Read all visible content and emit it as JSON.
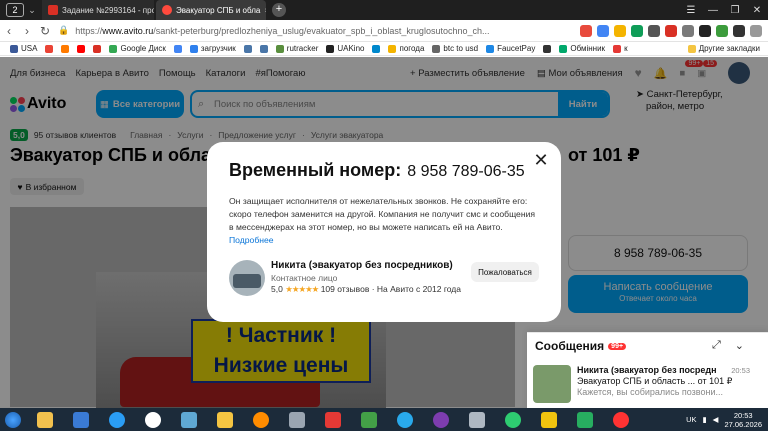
{
  "browser": {
    "tab_count": "2",
    "tabs": [
      {
        "title": "Задание №2993164 - про",
        "active": false,
        "favicon_color": "#d93025"
      },
      {
        "title": "Эвакуатор СПБ и обла",
        "active": true,
        "favicon_color": "#ff4a3d"
      }
    ],
    "url_prefix": "https://",
    "url_domain": "www.avito.ru",
    "url_path": "/sankt-peterburg/predlozheniya_uslug/evakuator_spb_i_oblast_kruglosutochno_ch...",
    "bookmarks": [
      {
        "label": "USA",
        "color": "#3b5998"
      },
      {
        "label": "",
        "color": "#ea4335"
      },
      {
        "label": "",
        "color": "#ff7a00"
      },
      {
        "label": "",
        "color": "#ff0000"
      },
      {
        "label": "",
        "color": "#d93025"
      },
      {
        "label": "Google Диск",
        "color": "#34a853"
      },
      {
        "label": "",
        "color": "#4285f4"
      },
      {
        "label": "загрузчик",
        "color": "#2f80ed"
      },
      {
        "label": "",
        "color": "#4a76a8"
      },
      {
        "label": "",
        "color": "#4a76a8"
      },
      {
        "label": "rutracker",
        "color": "#5a8f3e"
      },
      {
        "label": "UAKino",
        "color": "#222222"
      },
      {
        "label": "",
        "color": "#0088cc"
      },
      {
        "label": "погода",
        "color": "#f4b400"
      },
      {
        "label": "btc to usd",
        "color": "#666666"
      },
      {
        "label": "FaucetPay",
        "color": "#1e88e5"
      },
      {
        "label": "",
        "color": "#333333"
      },
      {
        "label": "Обмінник",
        "color": "#00a86b"
      },
      {
        "label": "к",
        "color": "#e53935"
      },
      {
        "label": "Другие закладки",
        "color": "#f4c542"
      }
    ]
  },
  "avito": {
    "top_links": [
      "Для бизнеса",
      "Карьера в Авито",
      "Помощь",
      "Каталоги",
      "#яПомогаю"
    ],
    "post_ad": "Разместить объявление",
    "my_ads": "Мои объявления",
    "notif_badge": "99+",
    "cart_badge": "15",
    "logo": "Avito",
    "all_categories": "Все категории",
    "search_placeholder": "Поиск по объявлениям",
    "search_button": "Найти",
    "city": "Санкт-Петербург,",
    "city_sub": "район, метро",
    "rating_value": "5,0",
    "reviews": "95 отзывов клиентов",
    "breadcrumbs": [
      "Главная",
      "Услуги",
      "Предложение услуг",
      "Услуги эвакуатора"
    ],
    "title": "Эвакуатор СПБ и обла",
    "title_price": "от 101 ₽",
    "favorite": "В избранном",
    "sign_line1": "! Частник !",
    "sign_line2": "Низкие цены",
    "phone_card": "8 958 789-06-35",
    "message_button": "Написать сообщение",
    "message_sub": "Отвечает около часа"
  },
  "chat": {
    "header": "Сообщения",
    "badge": "99+",
    "name": "Никита (эвакуатор без посредн",
    "time": "20:53",
    "preview": "Эвакуатор СПБ и область ... от 101 ₽",
    "message": "Кажется, вы собирались позвони..."
  },
  "modal": {
    "title": "Временный номер:",
    "phone": "8 958 789-06-35",
    "text": "Он защищает исполнителя от нежелательных звонков. Не сохраняйте его: скоро телефон заменится на другой. Компания не получит смс и сообщения в мессенджерах на этот номер, но вы можете написать ей на Авито.",
    "link": "Подробнее",
    "seller_name": "Никита (эвакуатор без посредников)",
    "seller_role": "Контактное лицо",
    "seller_rating": "5,0",
    "seller_stars": "★★★★★",
    "seller_reviews": "109 отзывов",
    "seller_since": "На Авито с 2012 года",
    "report": "Пожаловаться"
  },
  "taskbar": {
    "apps": [
      {
        "name": "file-explorer-icon",
        "color": "#f2c14e"
      },
      {
        "name": "app-icon",
        "color": "#3a7bd5"
      },
      {
        "name": "globe-icon",
        "color": "#2a9df4"
      },
      {
        "name": "yandex-browser-icon",
        "color": "#ffffff"
      },
      {
        "name": "window-icon",
        "color": "#5fa8d3"
      },
      {
        "name": "files-icon",
        "color": "#f5c542"
      },
      {
        "name": "media-player-icon",
        "color": "#ff8c00"
      },
      {
        "name": "settings-icon",
        "color": "#9aa5b1"
      },
      {
        "name": "app-64-icon",
        "color": "#e53935"
      },
      {
        "name": "game-icon",
        "color": "#43a047"
      },
      {
        "name": "telegram-icon",
        "color": "#29a9eb"
      },
      {
        "name": "viber-icon",
        "color": "#7d3daf"
      },
      {
        "name": "window2-icon",
        "color": "#aeb8c2"
      },
      {
        "name": "refresh-icon",
        "color": "#2ecc71"
      },
      {
        "name": "calendar-icon",
        "color": "#f1c40f"
      },
      {
        "name": "monitor-icon",
        "color": "#27ae60"
      },
      {
        "name": "yandex-icon",
        "color": "#ff3333"
      }
    ],
    "lang": "UK",
    "time": "20:53",
    "date": "27.06.2026"
  }
}
